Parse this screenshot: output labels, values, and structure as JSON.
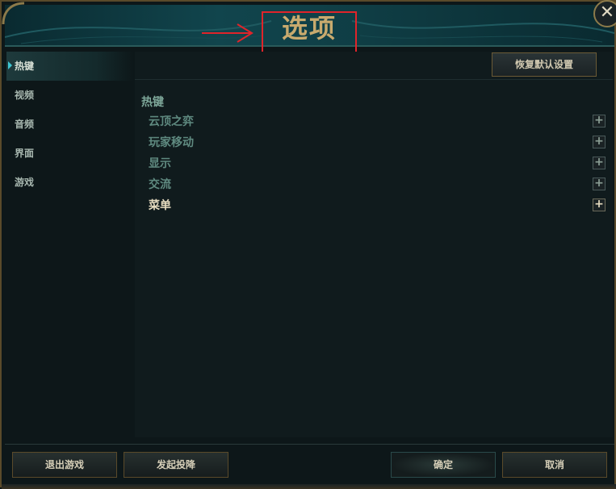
{
  "window": {
    "title": "选项",
    "close_glyph": "✕"
  },
  "sidebar": {
    "items": [
      {
        "label": "热键",
        "active": true
      },
      {
        "label": "视频"
      },
      {
        "label": "音频"
      },
      {
        "label": "界面"
      },
      {
        "label": "游戏"
      }
    ]
  },
  "panel": {
    "reset_label": "恢复默认设置",
    "section_title": "热键",
    "rows": [
      {
        "label": "云顶之弈",
        "toggle": "+"
      },
      {
        "label": "玩家移动",
        "toggle": "+"
      },
      {
        "label": "显示",
        "toggle": "+"
      },
      {
        "label": "交流",
        "toggle": "+"
      },
      {
        "label": "菜单",
        "toggle": "+",
        "active": true
      }
    ]
  },
  "footer": {
    "exit_label": "退出游戏",
    "surrender_label": "发起投降",
    "confirm_label": "确定",
    "cancel_label": "取消"
  },
  "annotations": {
    "highlight_color": "#e0242a"
  },
  "colors": {
    "gold": "#c8aa6e",
    "teal_accent": "#3fc6d2",
    "panel_bg": "#101b1d"
  },
  "icons": {
    "close": "close-icon",
    "caret": "caret-right-icon",
    "expand": "plus-icon",
    "annotation_arrow": "arrow-right-icon"
  }
}
